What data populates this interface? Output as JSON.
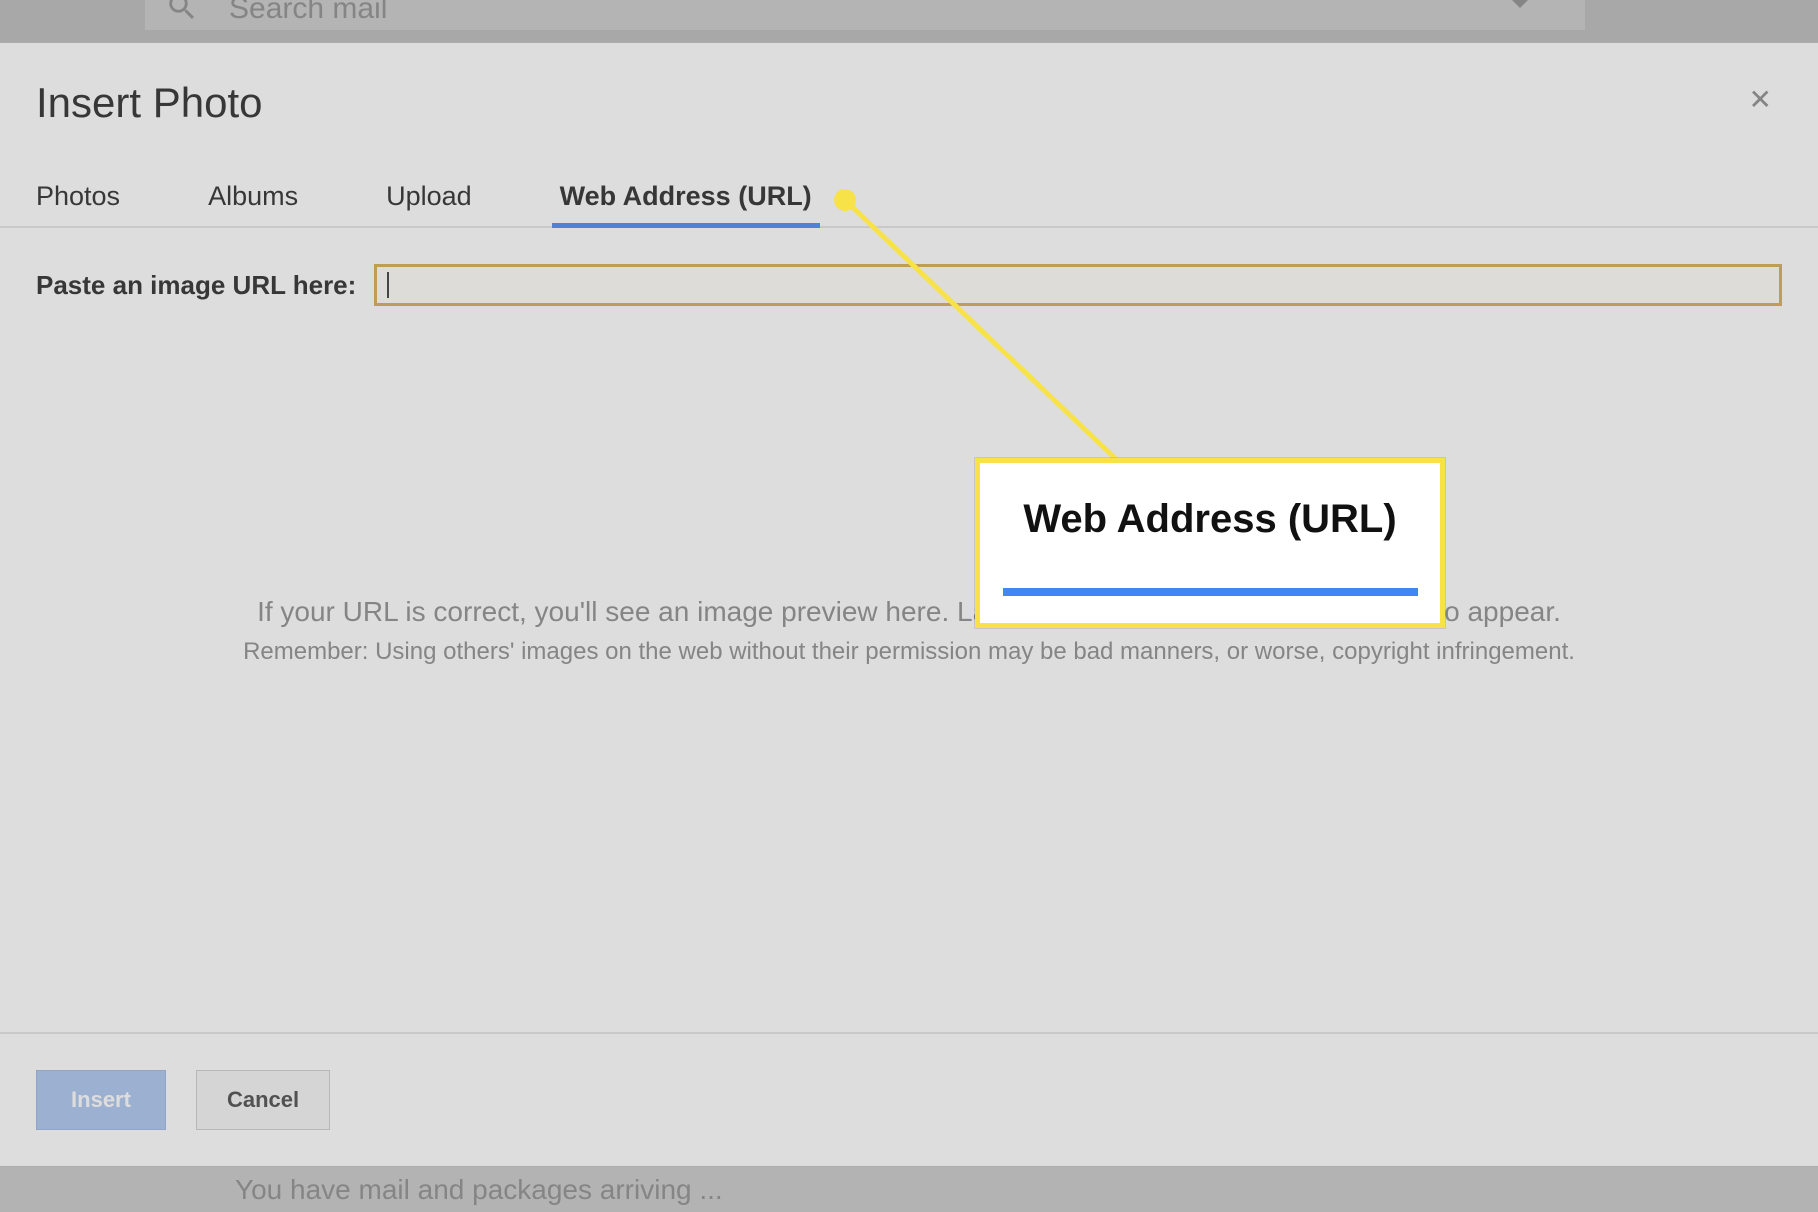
{
  "background": {
    "search_placeholder": "Search mail",
    "bottom_row_text": "You have mail and packages arriving ..."
  },
  "modal": {
    "title": "Insert Photo",
    "close_aria": "Close",
    "tabs": {
      "photos": "Photos",
      "albums": "Albums",
      "upload": "Upload",
      "web_url": "Web Address (URL)"
    },
    "url_section": {
      "label": "Paste an image URL here:",
      "input_value": "",
      "preview_hint": "If your URL is correct, you'll see an image preview here. Large images may take a few minutes to appear.",
      "copyright_hint": "Remember: Using others' images on the web without their permission may be bad manners, or worse, copyright infringement."
    },
    "buttons": {
      "insert": "Insert",
      "cancel": "Cancel"
    }
  },
  "annotation": {
    "callout_text": "Web Address (URL)"
  }
}
